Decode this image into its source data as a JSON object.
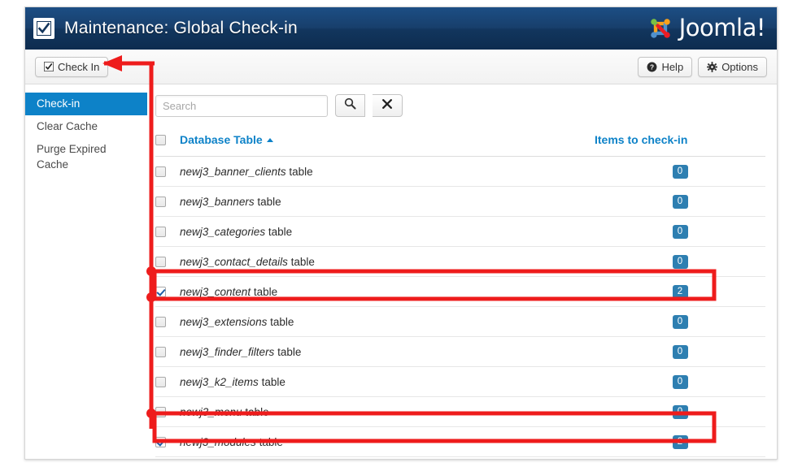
{
  "header": {
    "title": "Maintenance: Global Check-in",
    "checkbox_icon": "checkbox-checked-icon",
    "logo_text": "Joomla!",
    "logo_icon": "joomla-logo-icon"
  },
  "toolbar": {
    "checkin_label": "Check In",
    "checkin_icon": "checkbox-checked-icon",
    "help_label": "Help",
    "help_icon": "question-circle-icon",
    "options_label": "Options",
    "options_icon": "gear-icon"
  },
  "sidebar": {
    "items": [
      {
        "label": "Check-in",
        "active": true
      },
      {
        "label": "Clear Cache",
        "active": false
      },
      {
        "label": "Purge Expired Cache",
        "active": false
      }
    ]
  },
  "search": {
    "value": "",
    "placeholder": "Search",
    "search_icon": "search-icon",
    "clear_icon": "close-x-icon"
  },
  "table": {
    "headers": {
      "select_all": "",
      "name": "Database Table",
      "sort_direction": "ascending",
      "count": "Items to check-in"
    },
    "rows": [
      {
        "name": "newj3_banner_clients",
        "suffix": " table",
        "count": "0",
        "checked": false,
        "highlighted": false
      },
      {
        "name": "newj3_banners",
        "suffix": " table",
        "count": "0",
        "checked": false,
        "highlighted": false
      },
      {
        "name": "newj3_categories",
        "suffix": " table",
        "count": "0",
        "checked": false,
        "highlighted": false
      },
      {
        "name": "newj3_contact_details",
        "suffix": " table",
        "count": "0",
        "checked": false,
        "highlighted": false
      },
      {
        "name": "newj3_content",
        "suffix": " table",
        "count": "2",
        "checked": true,
        "highlighted": true
      },
      {
        "name": "newj3_extensions",
        "suffix": " table",
        "count": "0",
        "checked": false,
        "highlighted": false
      },
      {
        "name": "newj3_finder_filters",
        "suffix": " table",
        "count": "0",
        "checked": false,
        "highlighted": false
      },
      {
        "name": "newj3_k2_items",
        "suffix": " table",
        "count": "0",
        "checked": false,
        "highlighted": false
      },
      {
        "name": "newj3_menu",
        "suffix": " table",
        "count": "0",
        "checked": false,
        "highlighted": false
      },
      {
        "name": "newj3_modules",
        "suffix": " table",
        "count": "2",
        "checked": true,
        "highlighted": true
      }
    ]
  },
  "colors": {
    "header_blue": "#163f6d",
    "accent_blue": "#0d82c8",
    "badge_blue": "#2e7fb1",
    "annotation_red": "#ee1c1c"
  }
}
